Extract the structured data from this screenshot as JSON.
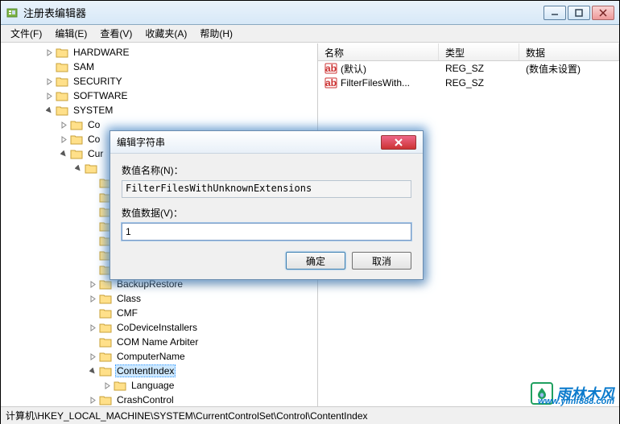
{
  "window": {
    "title": "注册表编辑器"
  },
  "menu": {
    "file": "文件(F)",
    "edit": "编辑(E)",
    "view": "查看(V)",
    "fav": "收藏夹(A)",
    "help": "帮助(H)"
  },
  "tree": {
    "items": [
      {
        "depth": 3,
        "exp": "closed",
        "label": "HARDWARE"
      },
      {
        "depth": 3,
        "exp": "none",
        "label": "SAM"
      },
      {
        "depth": 3,
        "exp": "closed",
        "label": "SECURITY"
      },
      {
        "depth": 3,
        "exp": "closed",
        "label": "SOFTWARE"
      },
      {
        "depth": 3,
        "exp": "open",
        "label": "SYSTEM"
      },
      {
        "depth": 4,
        "exp": "closed",
        "label": "Co"
      },
      {
        "depth": 4,
        "exp": "closed",
        "label": "Co"
      },
      {
        "depth": 4,
        "exp": "open",
        "label": "Cur"
      },
      {
        "depth": 5,
        "exp": "open",
        "label": ""
      },
      {
        "depth": 6,
        "exp": "none",
        "label": ""
      },
      {
        "depth": 6,
        "exp": "none",
        "label": ""
      },
      {
        "depth": 6,
        "exp": "none",
        "label": ""
      },
      {
        "depth": 6,
        "exp": "none",
        "label": ""
      },
      {
        "depth": 6,
        "exp": "none",
        "label": ""
      },
      {
        "depth": 6,
        "exp": "none",
        "label": ""
      },
      {
        "depth": 6,
        "exp": "none",
        "label": ""
      },
      {
        "depth": 6,
        "exp": "closed",
        "label": "BackupRestore"
      },
      {
        "depth": 6,
        "exp": "closed",
        "label": "Class"
      },
      {
        "depth": 6,
        "exp": "none",
        "label": "CMF"
      },
      {
        "depth": 6,
        "exp": "closed",
        "label": "CoDeviceInstallers"
      },
      {
        "depth": 6,
        "exp": "none",
        "label": "COM Name Arbiter"
      },
      {
        "depth": 6,
        "exp": "closed",
        "label": "ComputerName"
      },
      {
        "depth": 6,
        "exp": "open",
        "label": "ContentIndex",
        "selected": true
      },
      {
        "depth": 7,
        "exp": "closed",
        "label": "Language"
      },
      {
        "depth": 6,
        "exp": "closed",
        "label": "CrashControl"
      }
    ]
  },
  "list": {
    "cols": {
      "name": "名称",
      "type": "类型",
      "data": "数据"
    },
    "rows": [
      {
        "name": "(默认)",
        "type": "REG_SZ",
        "data": "(数值未设置)"
      },
      {
        "name": "FilterFilesWith...",
        "type": "REG_SZ",
        "data": ""
      }
    ]
  },
  "dialog": {
    "title": "编辑字符串",
    "name_label": "数值名称(N)：",
    "name_value": "FilterFilesWithUnknownExtensions",
    "data_label": "数值数据(V)：",
    "data_value": "1",
    "ok": "确定",
    "cancel": "取消"
  },
  "status": {
    "path": "计算机\\HKEY_LOCAL_MACHINE\\SYSTEM\\CurrentControlSet\\Control\\ContentIndex"
  },
  "watermark": {
    "brand": "雨林木风",
    "url": "www.ylmf888.com"
  }
}
